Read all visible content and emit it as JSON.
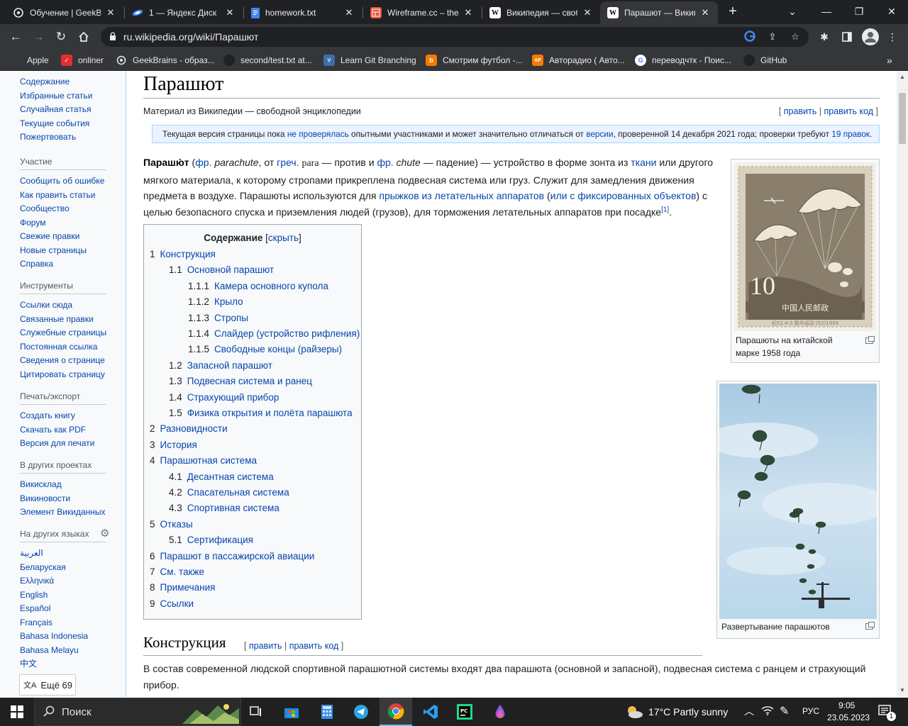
{
  "tabs": [
    {
      "title": "Обучение | GeekBrains",
      "icon": "geekbrains-icon"
    },
    {
      "title": "1 — Яндекс Диск",
      "icon": "yandex-disk-icon"
    },
    {
      "title": "homework.txt",
      "icon": "document-icon"
    },
    {
      "title": "Wireframe.cc – the",
      "icon": "wireframe-icon"
    },
    {
      "title": "Википедия — своб",
      "icon": "wikipedia-icon"
    },
    {
      "title": "Парашют — Википедия",
      "icon": "wikipedia-icon"
    }
  ],
  "toolbar": {
    "url": "ru.wikipedia.org/wiki/Парашют"
  },
  "bookmarks": [
    {
      "label": "Apple",
      "icon": "apple-icon"
    },
    {
      "label": "onliner",
      "icon": "onliner-icon"
    },
    {
      "label": "GeekBrains - образ...",
      "icon": "geekbrains-icon"
    },
    {
      "label": "second/test.txt at...",
      "icon": "github-icon"
    },
    {
      "label": "Learn Git Branching",
      "icon": "git-icon"
    },
    {
      "label": "Смотрим футбол -...",
      "icon": "football-icon"
    },
    {
      "label": "Авторадио ( Авто...",
      "icon": "autoradio-icon"
    },
    {
      "label": "переводчтк - Поис...",
      "icon": "google-icon"
    },
    {
      "label": "GitHub",
      "icon": "github-icon"
    }
  ],
  "sidebar": {
    "nav": [
      "Содержание",
      "Избранные статьи",
      "Случайная статья",
      "Текущие события",
      "Пожертвовать"
    ],
    "participation": {
      "heading": "Участие",
      "items": [
        "Сообщить об ошибке",
        "Как править статьи",
        "Сообщество",
        "Форум",
        "Свежие правки",
        "Новые страницы",
        "Справка"
      ]
    },
    "tools": {
      "heading": "Инструменты",
      "items": [
        "Ссылки сюда",
        "Связанные правки",
        "Служебные страницы",
        "Постоянная ссылка",
        "Сведения о странице",
        "Цитировать страницу"
      ]
    },
    "print": {
      "heading": "Печать/экспорт",
      "items": [
        "Создать книгу",
        "Скачать как PDF",
        "Версия для печати"
      ]
    },
    "projects": {
      "heading": "В других проектах",
      "items": [
        "Викисклад",
        "Викиновости",
        "Элемент Викиданных"
      ]
    },
    "languages": {
      "heading": "На других языках",
      "items": [
        "العربية",
        "Беларуская",
        "Ελληνικά",
        "English",
        "Español",
        "Français",
        "Bahasa Indonesia",
        "Bahasa Melayu",
        "中文"
      ],
      "more": "Ещё 69"
    }
  },
  "article": {
    "title": "Парашют",
    "subtitle": "Материал из Википедии — свободной энциклопедии",
    "edit_links": {
      "open": "[ ",
      "edit": "править",
      "sep": " | ",
      "edit_source": "править код",
      "close": " ]"
    },
    "notice": {
      "t1": "Текущая версия страницы пока ",
      "l1": "не проверялась",
      "t2": " опытными участниками и может значительно отличаться от ",
      "l2": "версии",
      "t3": ", проверенной 14 декабря 2021 года; проверки требуют ",
      "l3": "19 правок",
      "t4": "."
    },
    "intro": {
      "term": "Парашю́т",
      "p1": " (",
      "l_fr1": "фр.",
      "w_parachute": "parachute",
      "p2": ", от ",
      "l_greek": "греч.",
      "w_para": "para",
      "p3": " — против и ",
      "l_fr2": "фр.",
      "w_chute": "chute",
      "p4": " — падение) — устройство в форме зонта из ",
      "l_fabric": "ткани",
      "p5": " или другого мягкого материала, к которому стропами прикреплена подвесная система или груз. Служит для замедления движения предмета в воздухе. Парашюты используются для ",
      "l_jumps": "прыжков из летательных аппаратов",
      "p6": " (",
      "l_fixed": "или с фиксированных объектов",
      "p7": ") с целью безопасного спуска и приземления людей (грузов), для торможения летательных аппаратов при посадке",
      "ref": "[1]",
      "p8": "."
    },
    "toc": {
      "title": "Содержание",
      "toggle": "скрыть",
      "items": [
        {
          "num": "1",
          "label": "Конструкция",
          "level": 1
        },
        {
          "num": "1.1",
          "label": "Основной парашют",
          "level": 2
        },
        {
          "num": "1.1.1",
          "label": "Камера основного купола",
          "level": 3
        },
        {
          "num": "1.1.2",
          "label": "Крыло",
          "level": 3
        },
        {
          "num": "1.1.3",
          "label": "Стропы",
          "level": 3
        },
        {
          "num": "1.1.4",
          "label": "Слайдер (устройство рифления)",
          "level": 3
        },
        {
          "num": "1.1.5",
          "label": "Свободные концы (райзеры)",
          "level": 3
        },
        {
          "num": "1.2",
          "label": "Запасной парашют",
          "level": 2
        },
        {
          "num": "1.3",
          "label": "Подвесная система и ранец",
          "level": 2
        },
        {
          "num": "1.4",
          "label": "Страхующий прибор",
          "level": 2
        },
        {
          "num": "1.5",
          "label": "Физика открытия и полёта парашюта",
          "level": 2
        },
        {
          "num": "2",
          "label": "Разновидности",
          "level": 1
        },
        {
          "num": "3",
          "label": "История",
          "level": 1
        },
        {
          "num": "4",
          "label": "Парашютная система",
          "level": 1
        },
        {
          "num": "4.1",
          "label": "Десантная система",
          "level": 2
        },
        {
          "num": "4.2",
          "label": "Спасательная система",
          "level": 2
        },
        {
          "num": "4.3",
          "label": "Спортивная система",
          "level": 2
        },
        {
          "num": "5",
          "label": "Отказы",
          "level": 1
        },
        {
          "num": "5.1",
          "label": "Сертификация",
          "level": 2
        },
        {
          "num": "6",
          "label": "Парашют в пассажирской авиации",
          "level": 1
        },
        {
          "num": "7",
          "label": "См. также",
          "level": 1
        },
        {
          "num": "8",
          "label": "Примечания",
          "level": 1
        },
        {
          "num": "9",
          "label": "Ссылки",
          "level": 1
        }
      ]
    },
    "figure1": {
      "caption": "Парашюты на китайской марке 1958 года",
      "stamp_value": "10",
      "stamp_bottom_text": "中国人民邮政",
      "stamp_small_text": "纪52.4-3 跳伞运动 (52)1958"
    },
    "figure2": {
      "caption": "Развертывание парашютов"
    },
    "section1": {
      "title": "Конструкция",
      "text": "В состав современной людской спортивной парашютной системы входят два парашюта (основной и запасной), подвесная система с ранцем и страхующий прибор."
    }
  },
  "taskbar": {
    "search_placeholder": "Поиск",
    "weather": "17°C  Partly sunny",
    "lang": "РУС",
    "time": "9:05",
    "date": "23.05.2023",
    "notifications": "1"
  },
  "colors": {
    "link": "#0645ad",
    "chrome_dark": "#202124",
    "chrome_mid": "#35363a",
    "notice_bg": "#eaf3ff",
    "taskbar": "#202020"
  }
}
